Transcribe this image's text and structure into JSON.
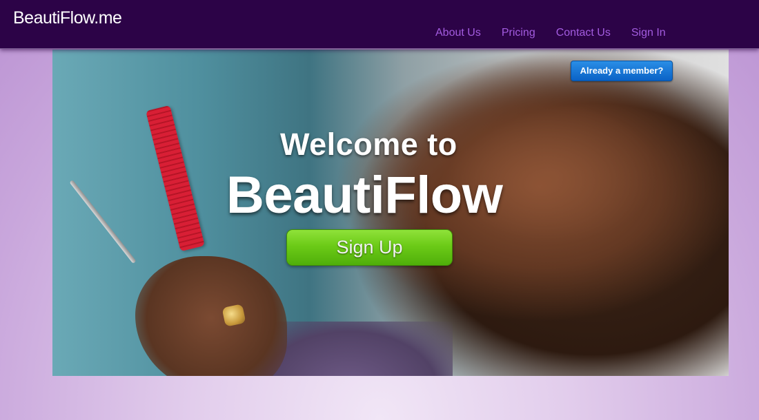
{
  "header": {
    "brand": "BeautiFlow.me",
    "nav": [
      "About Us",
      "Pricing",
      "Contact Us",
      "Sign In"
    ]
  },
  "hero": {
    "member_button": "Already a member?",
    "welcome": "Welcome to",
    "brand_title": "BeautiFlow",
    "signup_button": "Sign Up"
  },
  "colors": {
    "navbar_bg": "#2c0347",
    "nav_link": "#a35ce0",
    "page_bg": "#d8bde6",
    "member_button": "#0a62c6",
    "signup_button": "#6ccb17"
  }
}
